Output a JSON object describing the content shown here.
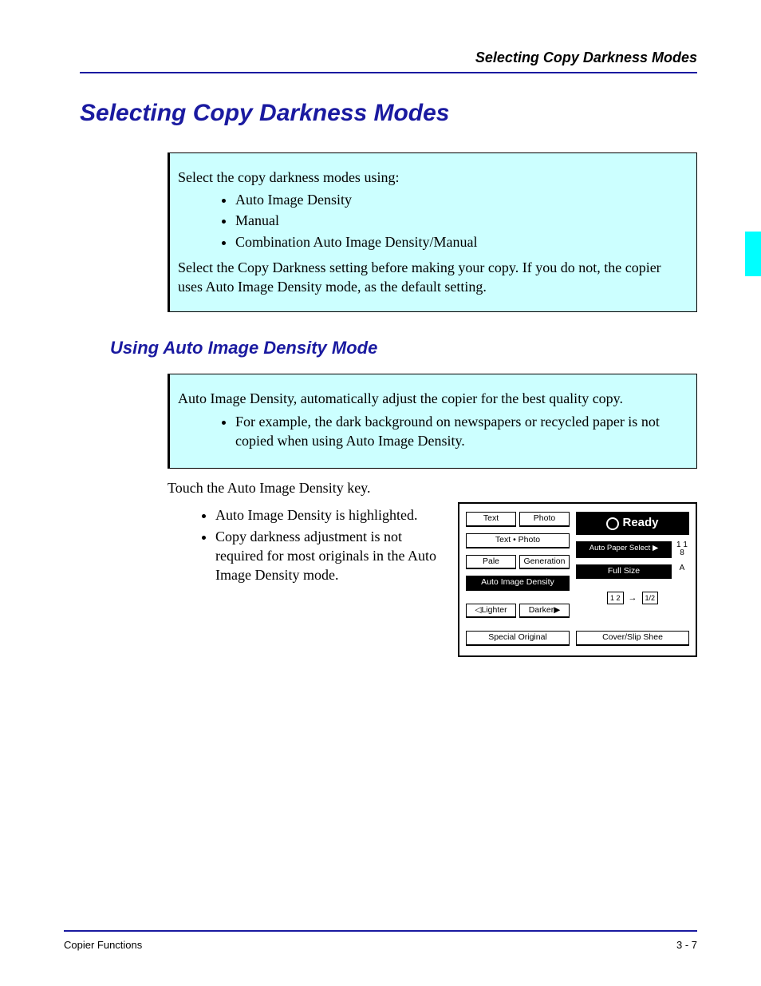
{
  "header": {
    "running": "Selecting Copy Darkness Modes"
  },
  "title": "Selecting Copy Darkness Modes",
  "callout1": {
    "intro": "Select the copy darkness modes using:",
    "items": [
      "Auto Image Density",
      "Manual",
      "Combination Auto Image Density/Manual"
    ],
    "outro": "Select the Copy Darkness setting before making your copy. If you do not, the copier uses Auto Image Density mode, as the default setting."
  },
  "h2": "Using Auto Image Density Mode",
  "callout2": {
    "intro": "Auto Image Density, automatically adjust the copier for the best quality copy.",
    "items": [
      "For example, the dark background on newspapers or recycled paper is not copied when using Auto Image Density."
    ]
  },
  "instruction": "Touch the Auto Image Density key.",
  "bullets": [
    "Auto Image Density is highlighted.",
    "Copy darkness adjustment is not required for most originals in the Auto Image Density mode."
  ],
  "panel": {
    "text": "Text",
    "photo": "Photo",
    "textphoto": "Text • Photo",
    "pale": "Pale",
    "generation": "Generation",
    "aid": "Auto Image Density",
    "lighter": "◁Lighter",
    "darker": "Darker▶",
    "special": "Special Original",
    "ready": "Ready",
    "autopaper": "Auto Paper Select ▶",
    "fullsize": "Full Size",
    "cover": "Cover/Slip Shee",
    "num_top": "1 1",
    "num_bot": "8",
    "sizeA": "A",
    "scale_src": "1 2",
    "scale_arrow": "→",
    "scale_dst": "1/2"
  },
  "footer": {
    "left": "Copier Functions",
    "right": "3 - 7"
  }
}
